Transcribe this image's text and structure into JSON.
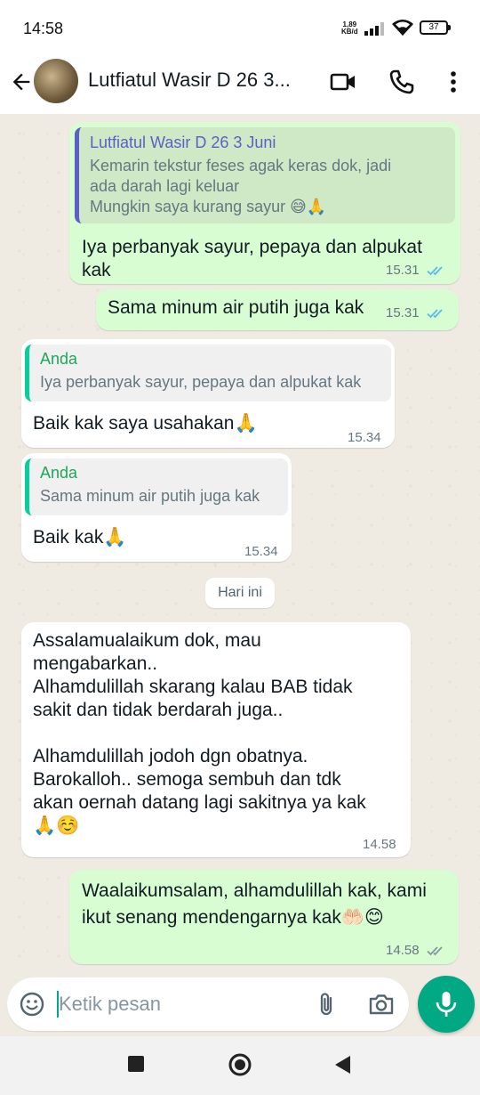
{
  "status_bar": {
    "time": "14:58",
    "speed_value": "1,89",
    "speed_unit": "KB/d",
    "battery": "37"
  },
  "header": {
    "contact_name": "Lutfiatul Wasir D 26 3...",
    "icons": [
      "back-arrow-icon",
      "video-call-icon",
      "voice-call-icon",
      "more-options-icon"
    ]
  },
  "messages": [
    {
      "direction": "outgoing",
      "quote_name": "Lutfiatul Wasir D 26 3 Juni",
      "quote_text": "Kemarin tekstur feses agak keras dok, jadi\nada darah lagi keluar\nMungkin saya kurang sayur 😅🙏",
      "text": "Iya perbanyak sayur, pepaya dan alpukat\nkak",
      "time": "15.31",
      "status": "read"
    },
    {
      "direction": "outgoing",
      "text": "Sama minum air putih juga kak",
      "time": "15.31",
      "status": "read"
    },
    {
      "direction": "incoming",
      "quote_name": "Anda",
      "quote_text": "Iya perbanyak sayur, pepaya dan alpukat kak",
      "text": "Baik kak saya usahakan🙏",
      "time": "15.34"
    },
    {
      "direction": "incoming",
      "quote_name": "Anda",
      "quote_text": "Sama minum air putih juga kak",
      "text": "Baik kak🙏",
      "time": "15.34"
    },
    {
      "direction": "incoming",
      "text": "Assalamualaikum dok, mau\nmengabarkan..\nAlhamdulillah skarang kalau BAB tidak\nsakit dan tidak berdarah juga..\n\nAlhamdulillah jodoh dgn obatnya.\nBarokalloh.. semoga sembuh dan tdk\nakan oernah datang lagi sakitnya ya kak\n🙏☺️",
      "time": "14.58"
    },
    {
      "direction": "outgoing",
      "text": "Waalaikumsalam, alhamdulillah kak, kami\nikut senang mendengarnya kak🤲🏻😊",
      "time": "14.58",
      "status": "delivered"
    }
  ],
  "day_divider": "Hari ini",
  "composer": {
    "placeholder": "Ketik pesan",
    "icons": [
      "emoji-icon",
      "attach-icon",
      "camera-icon",
      "mic-icon"
    ]
  },
  "colors": {
    "outgoing_bubble": "#d9fdd3",
    "incoming_bubble": "#ffffff",
    "accent": "#00a884",
    "read_ticks": "#53bdeb",
    "quote_author_out": "#5b5fc7",
    "quote_author_in": "#1fa855"
  }
}
